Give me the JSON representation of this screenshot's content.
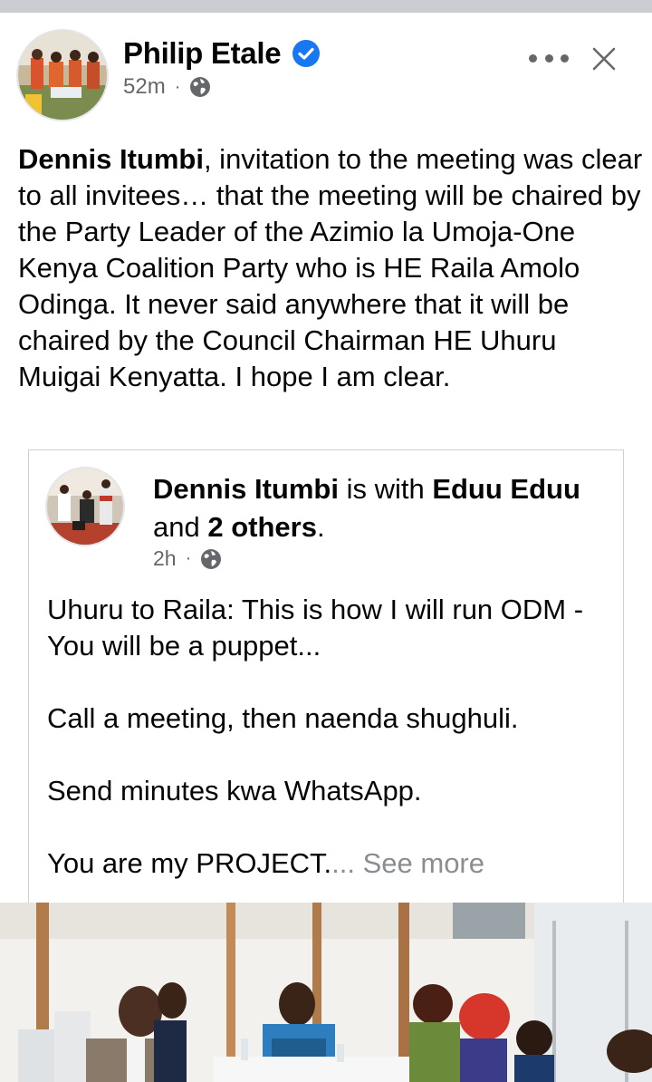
{
  "post": {
    "author": "Philip Etale",
    "time": "52m",
    "separator": "·",
    "privacy_icon": "globe-icon",
    "text_mention": "Dennis Itumbi",
    "text_body": ", invitation to the meeting was clear to all invitees… that the meeting will be chaired by the Party Leader of the Azimio la Umoja-One Kenya Coalition  Party who is HE Raila Amolo Odinga. It never said anywhere that it will be chaired by the Council Chairman HE Uhuru Muigai Kenyatta. I hope I am clear."
  },
  "shared": {
    "author": "Dennis Itumbi",
    "with_text": " is with ",
    "tagged": "Eduu Eduu",
    "and_text": " and ",
    "others": "2 others",
    "period": ".",
    "time": "2h",
    "separator": "·",
    "privacy_icon": "globe-icon",
    "text": "Uhuru to Raila: This is how I will run ODM - You will be a puppet...\n\nCall a meeting, then naenda shughuli.\n\nSend minutes kwa WhatsApp.\n\nYou are my PROJECT.",
    "see_more_prefix": "...",
    "see_more": " See more"
  },
  "colors": {
    "verified": "#1877f2",
    "secondary_text": "#65676b",
    "see_more": "#8a8d91",
    "card_border": "#ced0d4"
  }
}
